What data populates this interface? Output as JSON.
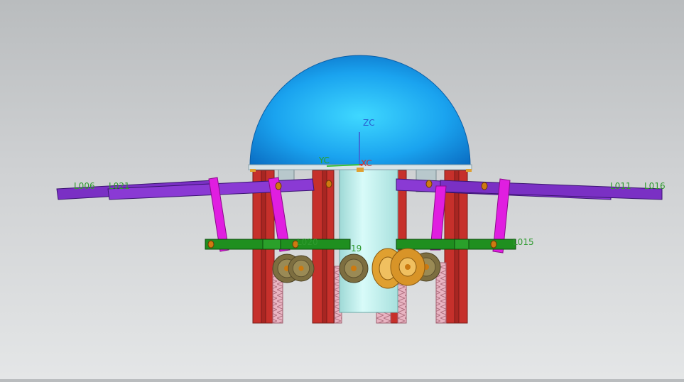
{
  "view": {
    "axes": {
      "zc": "ZC",
      "yc": "YC",
      "xc": "XC"
    },
    "labels": {
      "l006": "L006",
      "l021": "L021",
      "l011": "L011",
      "l016": "L016",
      "l020": "L020",
      "l015": "L015",
      "l019": "19"
    },
    "colors": {
      "dome": "#1aa3ef",
      "column": "#c6302b",
      "cylinder": "#bff0ee",
      "arm": "#7a30c4",
      "link": "#e01ee0",
      "bar": "#1f8f1f",
      "gear": "#8a7a45",
      "bevel_gear": "#e0a030",
      "rack": "#e8a8b8",
      "label_text": "#2f9a2f"
    }
  }
}
